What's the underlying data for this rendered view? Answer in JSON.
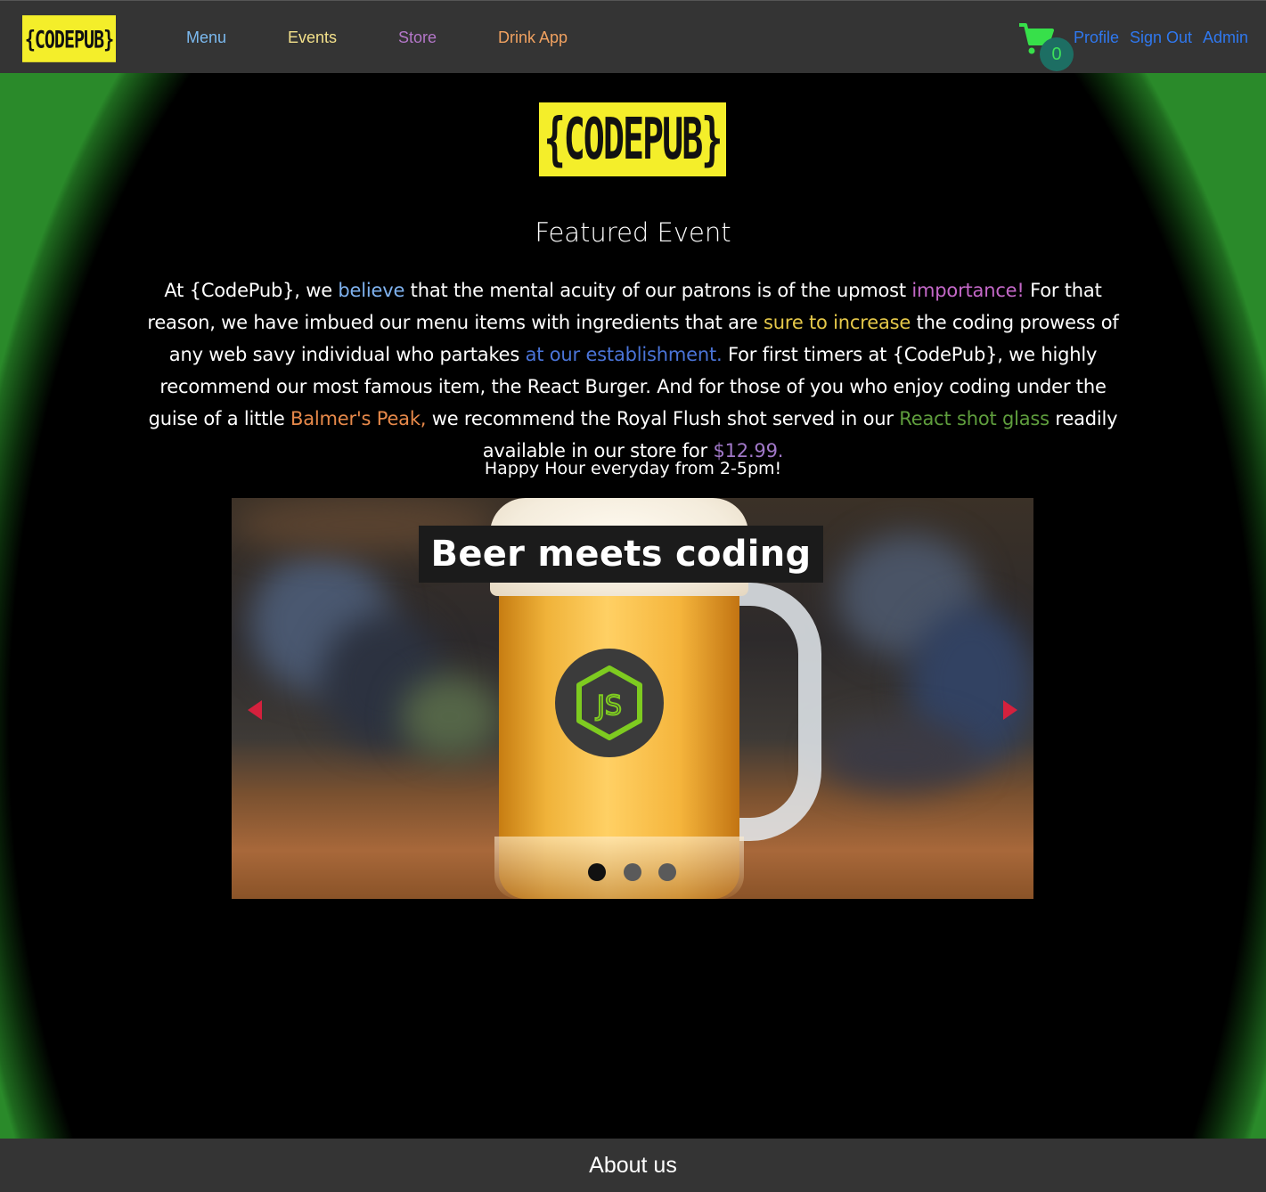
{
  "nav": {
    "logo_text": "{CODEPUB}",
    "links": [
      {
        "label": "Menu",
        "color": "#7bb9ef"
      },
      {
        "label": "Events",
        "color": "#f3e08a"
      },
      {
        "label": "Store",
        "color": "#b477c9"
      },
      {
        "label": "Drink App",
        "color": "#f0a160"
      }
    ],
    "cart": {
      "icon": "shopping-cart-icon",
      "count": "0",
      "color": "#37e04a"
    },
    "auth_links": [
      "Profile",
      "Sign Out",
      "Admin"
    ]
  },
  "main": {
    "logo_text": "{CODEPUB}",
    "featured_title": "Featured Event",
    "intro": {
      "p1": "At {CodePub}, we ",
      "believe": "believe",
      "p2": " that the mental acuity of our patrons is of the upmost ",
      "importance": "importance!",
      "p3": " For that reason, we have imbued our menu items with ingredients that are ",
      "sure": "sure to increase",
      "p4": " the coding prowess of any web savy individual who partakes ",
      "establishment": "at our establishment.",
      "p5": " For first timers at {CodePub}, we highly recommend our most famous item, the React Burger. And for those of you who enjoy coding under the guise of a little ",
      "balmer": "Balmer's Peak,",
      "p6": " we recommend the Royal Flush shot served in our ",
      "shot_glass": "React shot glass",
      "p7": " readily available in our store for ",
      "price": "$12.99."
    },
    "happy_hour": "Happy Hour everyday from 2-5pm!",
    "carousel": {
      "caption": "Beer meets coding",
      "badge_text": "JS",
      "prev_icon": "chevron-left-icon",
      "next_icon": "chevron-right-icon",
      "arrow_color": "#d4213d",
      "slide_count": 3,
      "active_index": 0
    }
  },
  "footer": {
    "title": "About us"
  }
}
